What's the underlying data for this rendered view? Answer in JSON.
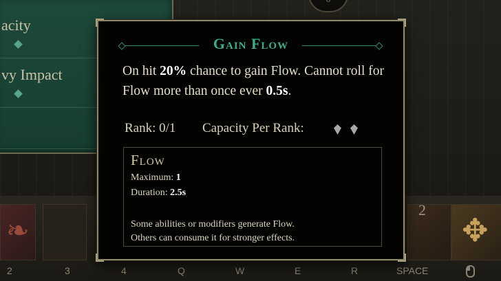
{
  "background": {
    "skill_rows": [
      "acity",
      "vy Impact"
    ],
    "ornament_value": "0",
    "hotbar_number": "2",
    "keys": [
      "2",
      "3",
      "4",
      "Q",
      "W",
      "E",
      "R",
      "SPACE"
    ]
  },
  "tooltip": {
    "title": "Gain Flow",
    "description": {
      "part1": "On hit ",
      "chance": "20%",
      "part2": " chance to gain Flow. Cannot roll for Flow more than once ever ",
      "interval": "0.5s",
      "part3": "."
    },
    "rank_label": "Rank: 0/1",
    "capacity_label": "Capacity Per Rank:",
    "capacity_pips": 2,
    "subbox": {
      "title": "Flow",
      "maximum_label": "Maximum: ",
      "maximum_value": "1",
      "duration_label": "Duration: ",
      "duration_value": "2.5s",
      "description_line1": "Some abilities or modifiers generate Flow.",
      "description_line2": "Others can consume it for stronger effects."
    }
  },
  "colors": {
    "accent": "#35b08d",
    "panel_green": "#1d4a3b",
    "tooltip_bg": "#030302",
    "border": "#8f8869"
  }
}
